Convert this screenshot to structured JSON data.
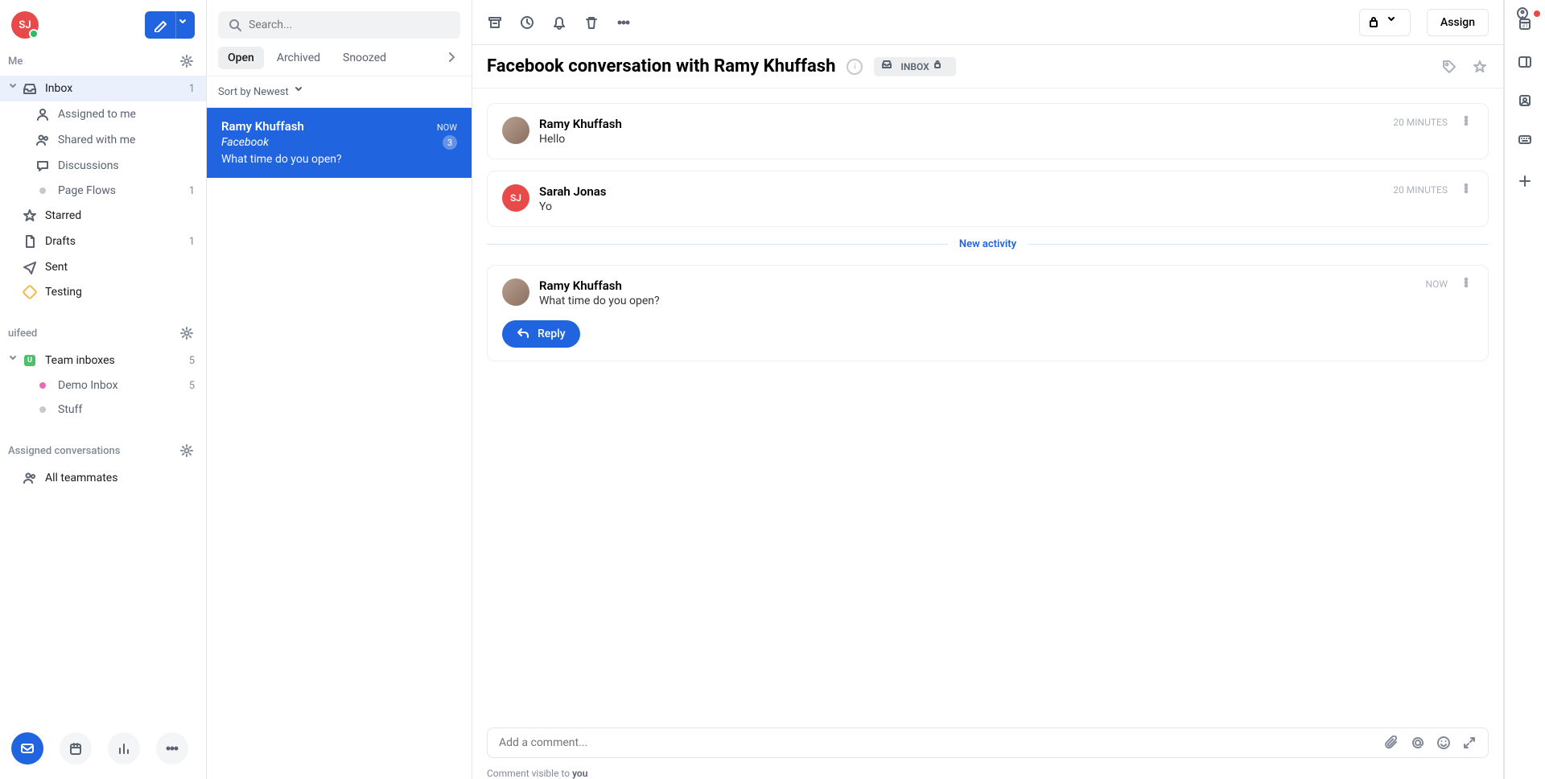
{
  "user": {
    "initials": "SJ"
  },
  "sections": {
    "me": "Me",
    "uifeed": "uifeed",
    "assigned": "Assigned conversations"
  },
  "nav": {
    "inbox": {
      "label": "Inbox",
      "count": "1"
    },
    "assigned_to_me": {
      "label": "Assigned to me"
    },
    "shared_with_me": {
      "label": "Shared with me"
    },
    "discussions": {
      "label": "Discussions"
    },
    "page_flows": {
      "label": "Page Flows",
      "count": "1"
    },
    "starred": {
      "label": "Starred"
    },
    "drafts": {
      "label": "Drafts",
      "count": "1"
    },
    "sent": {
      "label": "Sent"
    },
    "testing": {
      "label": "Testing"
    },
    "team_inboxes": {
      "label": "Team inboxes",
      "count": "5"
    },
    "demo_inbox": {
      "label": "Demo Inbox",
      "count": "5"
    },
    "stuff": {
      "label": "Stuff"
    },
    "all_teammates": {
      "label": "All teammates"
    }
  },
  "search": {
    "placeholder": "Search..."
  },
  "filters": {
    "open": "Open",
    "archived": "Archived",
    "snoozed": "Snoozed"
  },
  "sort": {
    "label": "Sort by Newest"
  },
  "list": [
    {
      "name": "Ramy Khuffash",
      "time": "NOW",
      "source": "Facebook",
      "badge": "3",
      "preview": "What time do you open?"
    }
  ],
  "conversation": {
    "title": "Facebook conversation with Ramy Khuffash",
    "chip": "INBOX",
    "assign": "Assign"
  },
  "messages": [
    {
      "author": "Ramy Khuffash",
      "text": "Hello",
      "time": "20 MINUTES",
      "avatar": "photo"
    },
    {
      "author": "Sarah Jonas",
      "text": "Yo",
      "time": "20 MINUTES",
      "avatar": "sj"
    }
  ],
  "activity_label": "New activity",
  "new_message": {
    "author": "Ramy Khuffash",
    "text": "What time do you open?",
    "time": "NOW",
    "avatar": "photo"
  },
  "reply_label": "Reply",
  "composer": {
    "placeholder": "Add a comment...",
    "visibility_prefix": "Comment visible to ",
    "visibility_target": "you"
  }
}
